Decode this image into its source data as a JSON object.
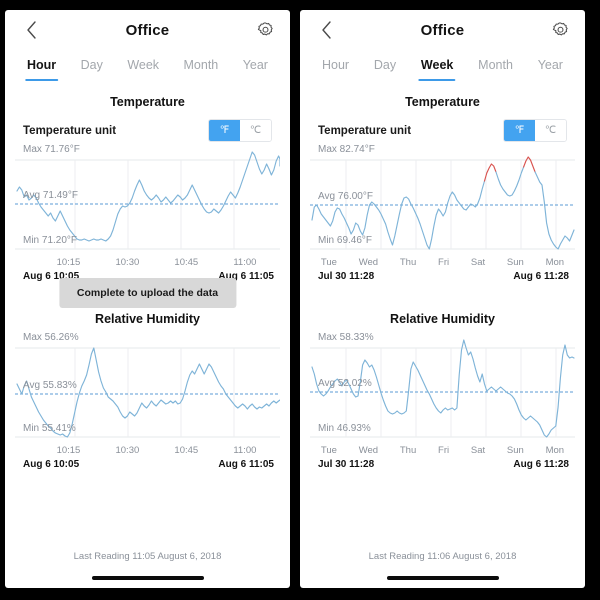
{
  "screens": [
    {
      "id": "hour-view",
      "header": {
        "title": "Office",
        "back_icon": "chevron-left-icon",
        "settings_icon": "gear-icon"
      },
      "tabs": [
        {
          "label": "Hour",
          "active": true
        },
        {
          "label": "Day",
          "active": false
        },
        {
          "label": "Week",
          "active": false
        },
        {
          "label": "Month",
          "active": false
        },
        {
          "label": "Year",
          "active": false
        }
      ],
      "temperature": {
        "section_title": "Temperature",
        "unit_label": "Temperature unit",
        "unit_options": [
          "℉",
          "℃"
        ],
        "unit_selected": "℉",
        "max_label": "Max 71.76°F",
        "avg_label": "Avg 71.49°F",
        "min_label": "Min 71.20°F",
        "x_ticks": [
          "10:15",
          "10:30",
          "10:45",
          "11:00"
        ],
        "range_start": "Aug 6  10:05",
        "range_end": "Aug 6  11:05"
      },
      "humidity": {
        "section_title": "Relative Humidity",
        "max_label": "Max 56.26%",
        "avg_label": "Avg 55.83%",
        "min_label": "Min 55.41%",
        "x_ticks": [
          "10:15",
          "10:30",
          "10:45",
          "11:00"
        ],
        "range_start": "Aug 6  10:05",
        "range_end": "Aug 6  11:05"
      },
      "toast": "Complete to upload the data",
      "footer": "Last Reading 11:05 August 6, 2018"
    },
    {
      "id": "week-view",
      "header": {
        "title": "Office",
        "back_icon": "chevron-left-icon",
        "settings_icon": "gear-icon"
      },
      "tabs": [
        {
          "label": "Hour",
          "active": false
        },
        {
          "label": "Day",
          "active": false
        },
        {
          "label": "Week",
          "active": true
        },
        {
          "label": "Month",
          "active": false
        },
        {
          "label": "Year",
          "active": false
        }
      ],
      "temperature": {
        "section_title": "Temperature",
        "unit_label": "Temperature unit",
        "unit_options": [
          "℉",
          "℃"
        ],
        "unit_selected": "℉",
        "max_label": "Max 82.74°F",
        "avg_label": "Avg 76.00°F",
        "min_label": "Min 69.46°F",
        "x_ticks": [
          "Tue",
          "Wed",
          "Thu",
          "Fri",
          "Sat",
          "Sun",
          "Mon"
        ],
        "range_start": "Jul 30  11:28",
        "range_end": "Aug 6  11:28"
      },
      "humidity": {
        "section_title": "Relative Humidity",
        "max_label": "Max 58.33%",
        "avg_label": "Avg 52.02%",
        "min_label": "Min 46.93%",
        "x_ticks": [
          "Tue",
          "Wed",
          "Thu",
          "Fri",
          "Sat",
          "Sun",
          "Mon"
        ],
        "range_start": "Jul 30  11:28",
        "range_end": "Aug 6  11:28"
      },
      "toast": null,
      "footer": "Last Reading 11:06 August 6, 2018"
    }
  ],
  "colors": {
    "accent": "#3d9ae8",
    "line": "#7fb4d8",
    "alert_line": "#d9534f",
    "grid": "#e6e8eb",
    "muted_text": "#8a9099",
    "toast_bg": "#d8d8d8"
  },
  "chart_data": [
    {
      "type": "line",
      "id": "hour-temperature",
      "title": "Temperature",
      "ylabel": "°F",
      "xlabel": "",
      "grid": true,
      "legend": "none",
      "ylim": [
        71.2,
        71.76
      ],
      "annotations": {
        "max": 71.76,
        "avg": 71.49,
        "min": 71.2
      },
      "x_tick_labels": [
        "10:15",
        "10:30",
        "10:45",
        "11:00"
      ],
      "x_range": [
        "Aug 6 10:05",
        "Aug 6 11:05"
      ],
      "values": [
        71.52,
        71.56,
        71.53,
        71.49,
        71.5,
        71.47,
        71.48,
        71.5,
        71.47,
        71.44,
        71.42,
        71.4,
        71.38,
        71.36,
        71.38,
        71.35,
        71.33,
        71.36,
        71.39,
        71.36,
        71.33,
        71.3,
        71.28,
        71.26,
        71.24,
        71.22,
        71.21,
        71.21,
        71.22,
        71.21,
        71.2,
        71.21,
        71.22,
        71.21,
        71.21,
        71.22,
        71.21,
        71.2,
        71.22,
        71.24,
        71.28,
        71.33,
        71.38,
        71.41,
        71.43,
        71.42,
        71.43,
        71.45,
        71.48,
        71.52,
        71.56,
        71.59,
        71.56,
        71.52,
        71.49,
        71.47,
        71.46,
        71.47,
        71.49,
        71.47,
        71.45,
        71.46,
        71.48,
        71.5,
        71.48,
        71.46,
        71.47,
        71.49,
        71.51,
        71.5,
        71.48,
        71.47,
        71.49,
        71.52,
        71.55,
        71.52,
        71.49,
        71.46,
        71.43,
        71.41,
        71.4,
        71.41,
        71.43,
        71.42,
        71.41,
        71.43,
        71.46,
        71.5,
        71.53,
        71.51,
        71.49,
        71.52,
        71.56,
        71.6,
        71.64,
        71.68,
        71.72,
        71.76,
        71.74,
        71.7,
        71.66,
        71.63,
        71.65,
        71.68,
        71.65,
        71.62,
        71.64,
        71.7,
        71.74,
        71.72,
        71.68,
        71.66,
        71.69
      ]
    },
    {
      "type": "line",
      "id": "hour-humidity",
      "title": "Relative Humidity",
      "ylabel": "%",
      "xlabel": "",
      "grid": true,
      "legend": "none",
      "ylim": [
        55.41,
        56.26
      ],
      "annotations": {
        "max": 56.26,
        "avg": 55.83,
        "min": 55.41
      },
      "x_tick_labels": [
        "10:15",
        "10:30",
        "10:45",
        "11:00"
      ],
      "x_range": [
        "Aug 6 10:05",
        "Aug 6 11:05"
      ],
      "values": [
        55.88,
        55.84,
        55.8,
        55.86,
        55.9,
        55.84,
        55.78,
        55.74,
        55.7,
        55.66,
        55.62,
        55.58,
        55.55,
        55.52,
        55.5,
        55.47,
        55.45,
        55.44,
        55.43,
        55.44,
        55.42,
        55.41,
        55.44,
        55.52,
        55.62,
        55.72,
        55.8,
        55.86,
        55.9,
        55.96,
        56.04,
        56.14,
        56.26,
        56.14,
        56.02,
        55.94,
        55.88,
        55.84,
        55.8,
        55.78,
        55.76,
        55.73,
        55.7,
        55.66,
        55.62,
        55.6,
        55.62,
        55.66,
        55.64,
        55.62,
        55.65,
        55.7,
        55.74,
        55.72,
        55.7,
        55.72,
        55.76,
        55.8,
        55.78,
        55.76,
        55.78,
        55.82,
        55.8,
        55.78,
        55.77,
        55.78,
        55.8,
        55.78,
        55.79,
        55.82,
        55.88,
        55.96,
        56.02,
        56.06,
        56.04,
        56.08,
        56.12,
        56.08,
        56.04,
        56.08,
        56.12,
        56.1,
        56.06,
        56.02,
        55.98,
        55.96,
        55.92,
        55.88,
        55.84,
        55.82,
        55.8,
        55.78,
        55.76,
        55.74,
        55.72,
        55.74,
        55.76,
        55.74,
        55.72,
        55.74,
        55.76,
        55.74,
        55.73,
        55.75,
        55.77,
        55.76,
        55.75,
        55.77,
        55.79,
        55.78,
        55.77,
        55.79,
        55.8
      ]
    },
    {
      "type": "line",
      "id": "week-temperature",
      "title": "Temperature",
      "ylabel": "°F",
      "xlabel": "",
      "grid": true,
      "legend": "none",
      "ylim": [
        69.46,
        82.74
      ],
      "annotations": {
        "max": 82.74,
        "avg": 76.0,
        "min": 69.46
      },
      "x_tick_labels": [
        "Tue",
        "Wed",
        "Thu",
        "Fri",
        "Sat",
        "Sun",
        "Mon"
      ],
      "x_range": [
        "Jul 30 11:28",
        "Aug 6 11:28"
      ],
      "alert_threshold": 80.0,
      "values": [
        73.8,
        75.6,
        75.8,
        75.2,
        74.6,
        74.2,
        73.8,
        73.4,
        73.0,
        73.6,
        74.8,
        75.4,
        75.2,
        74.6,
        74.0,
        73.4,
        72.6,
        71.8,
        72.4,
        73.4,
        73.0,
        72.2,
        71.6,
        72.6,
        74.4,
        75.8,
        76.2,
        76.0,
        75.6,
        75.2,
        74.6,
        74.0,
        73.2,
        72.2,
        71.2,
        70.4,
        71.6,
        73.2,
        74.8,
        76.2,
        77.0,
        77.2,
        76.8,
        76.2,
        75.6,
        75.0,
        74.2,
        73.4,
        72.4,
        71.4,
        70.4,
        69.8,
        71.2,
        73.0,
        74.6,
        75.4,
        75.0,
        74.6,
        75.2,
        76.4,
        77.4,
        78.0,
        77.6,
        77.0,
        76.6,
        76.2,
        75.8,
        75.6,
        76.0,
        76.4,
        76.2,
        76.0,
        76.4,
        77.2,
        78.4,
        79.6,
        80.6,
        81.2,
        81.0,
        80.2,
        79.2,
        78.4,
        77.8,
        77.4,
        77.0,
        76.8,
        77.0,
        77.6,
        78.4,
        79.4,
        80.4,
        81.4,
        82.2,
        82.74,
        82.2,
        81.4,
        80.4,
        79.6,
        79.0,
        78.4,
        76.0,
        73.0,
        71.4,
        70.6,
        70.0,
        69.6,
        69.46,
        70.2,
        70.8,
        71.4,
        71.2,
        70.8,
        71.6
      ]
    },
    {
      "type": "line",
      "id": "week-humidity",
      "title": "Relative Humidity",
      "ylabel": "%",
      "xlabel": "",
      "grid": true,
      "legend": "none",
      "ylim": [
        46.93,
        58.33
      ],
      "annotations": {
        "max": 58.33,
        "avg": 52.02,
        "min": 46.93
      },
      "x_tick_labels": [
        "Tue",
        "Wed",
        "Thu",
        "Fri",
        "Sat",
        "Sun",
        "Mon"
      ],
      "x_range": [
        "Jul 30 11:28",
        "Aug 6 11:28"
      ],
      "values": [
        55.4,
        54.6,
        53.4,
        52.6,
        52.2,
        52.0,
        52.2,
        52.6,
        53.0,
        53.4,
        53.8,
        54.0,
        53.6,
        53.2,
        53.6,
        53.8,
        53.4,
        52.8,
        52.2,
        51.8,
        52.0,
        53.6,
        55.6,
        56.2,
        55.8,
        55.4,
        55.6,
        55.0,
        54.2,
        53.2,
        52.2,
        51.4,
        50.6,
        50.0,
        49.8,
        49.6,
        49.8,
        50.0,
        49.8,
        49.6,
        49.8,
        50.0,
        52.4,
        55.0,
        55.8,
        55.4,
        55.0,
        54.4,
        53.8,
        53.2,
        52.6,
        52.0,
        51.4,
        50.8,
        50.2,
        49.8,
        49.6,
        50.0,
        50.2,
        49.9,
        50.1,
        50.2,
        50.0,
        50.2,
        54.0,
        57.2,
        58.33,
        57.4,
        56.6,
        57.0,
        56.2,
        55.2,
        54.2,
        53.4,
        54.4,
        53.2,
        52.4,
        52.6,
        52.8,
        52.6,
        52.4,
        52.6,
        52.8,
        52.6,
        52.4,
        52.2,
        52.0,
        51.8,
        51.4,
        50.8,
        50.0,
        49.4,
        49.0,
        48.8,
        49.0,
        49.2,
        49.0,
        48.8,
        48.6,
        48.2,
        47.6,
        47.0,
        46.93,
        47.2,
        47.6,
        47.8,
        48.0,
        50.4,
        54.0,
        57.0,
        58.2,
        57.0,
        56.6
      ]
    }
  ]
}
